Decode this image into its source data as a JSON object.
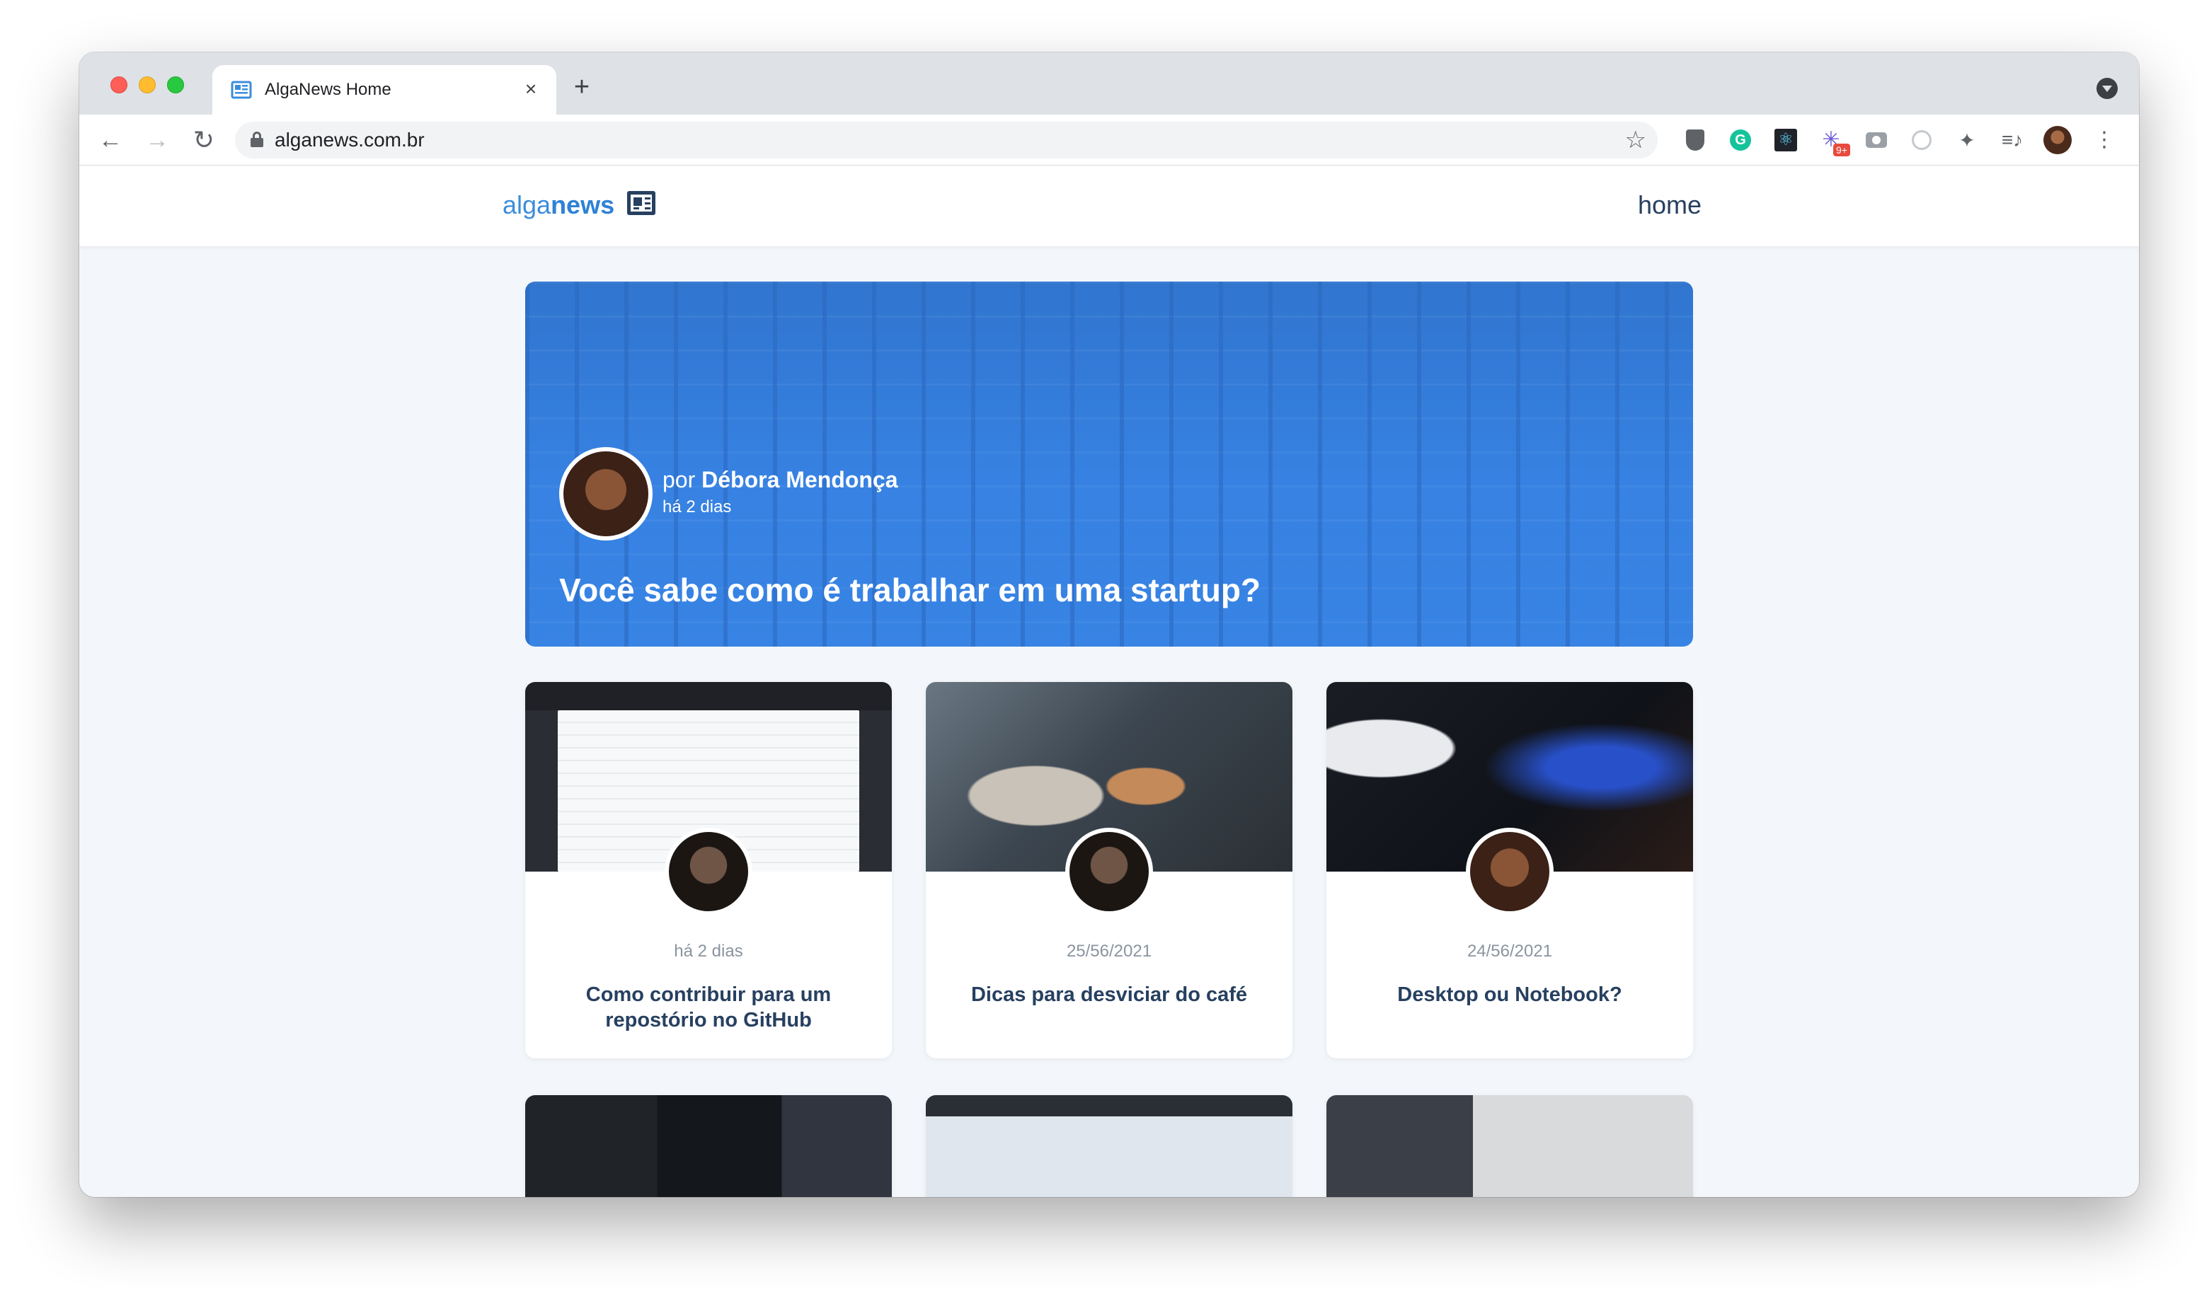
{
  "browser": {
    "tab_title": "AlgaNews Home",
    "tab_close": "×",
    "new_tab": "+",
    "url": "alganews.com.br",
    "ext_badge": "9+"
  },
  "site": {
    "logo_alga": "alga",
    "logo_news": "news",
    "nav_home": "home"
  },
  "hero": {
    "by_prefix": "por",
    "author": "Débora Mendonça",
    "when": "há 2 dias",
    "title": "Você sabe como é trabalhar em uma startup?"
  },
  "posts": [
    {
      "date": "há 2 dias",
      "title": "Como contribuir para um repostório no GitHub"
    },
    {
      "date": "25/56/2021",
      "title": "Dicas para desviciar do café"
    },
    {
      "date": "24/56/2021",
      "title": "Desktop ou Notebook?"
    }
  ]
}
